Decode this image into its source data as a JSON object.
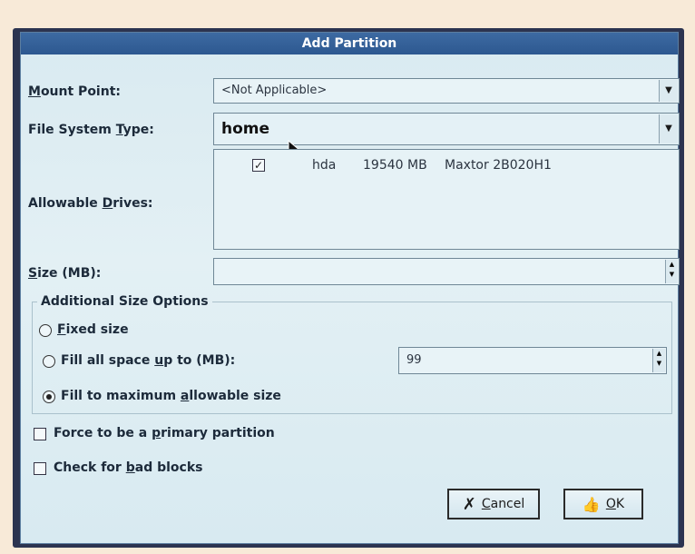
{
  "dialog": {
    "title": "Add Partition"
  },
  "mount_point": {
    "label_pre": "",
    "label_mnemonic": "M",
    "label_post": "ount Point:",
    "value": "<Not Applicable>"
  },
  "fs_type": {
    "label_pre": "File System ",
    "label_mnemonic": "T",
    "label_post": "ype:",
    "value": "home"
  },
  "drives": {
    "label_pre": "Allowable ",
    "label_mnemonic": "D",
    "label_post": "rives:",
    "rows": [
      {
        "checked": true,
        "device": "hda",
        "size": "19540 MB",
        "model": "Maxtor 2B020H1"
      }
    ]
  },
  "size": {
    "label_pre": "",
    "label_mnemonic": "S",
    "label_post": "ize (MB):",
    "value": ""
  },
  "additional": {
    "title": "Additional Size Options",
    "fixed": {
      "pre": "",
      "mn": "F",
      "post": "ixed size",
      "selected": false
    },
    "fill_up_to": {
      "pre": "Fill all space ",
      "mn": "u",
      "post": "p to (MB):",
      "selected": false,
      "value": "99"
    },
    "fill_max": {
      "pre": "Fill to maximum ",
      "mn": "a",
      "post": "llowable size",
      "selected": true
    }
  },
  "primary": {
    "pre": "Force to be a ",
    "mn": "p",
    "post": "rimary partition",
    "checked": false
  },
  "badblocks": {
    "pre": "Check for ",
    "mn": "b",
    "post": "ad blocks",
    "checked": false
  },
  "buttons": {
    "cancel": {
      "mn": "C",
      "post": "ancel"
    },
    "ok": {
      "mn": "O",
      "post": "K"
    }
  }
}
